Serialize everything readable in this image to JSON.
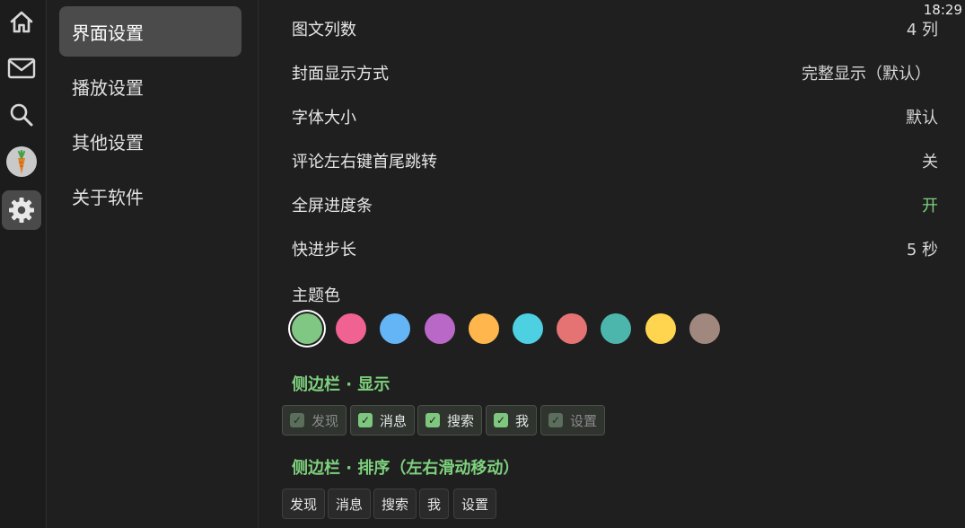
{
  "status": {
    "time": "18:29"
  },
  "rail": {
    "items": [
      {
        "name": "home",
        "icon": "home-icon"
      },
      {
        "name": "messages",
        "icon": "mail-icon"
      },
      {
        "name": "search",
        "icon": "search-icon"
      },
      {
        "name": "me",
        "icon": "avatar-carrot-icon"
      },
      {
        "name": "settings",
        "icon": "gear-icon",
        "active": true
      }
    ]
  },
  "menu": {
    "items": [
      {
        "label": "界面设置",
        "active": true
      },
      {
        "label": "播放设置"
      },
      {
        "label": "其他设置"
      },
      {
        "label": "关于软件"
      }
    ]
  },
  "settings": [
    {
      "label": "图文列数",
      "value": "4 列"
    },
    {
      "label": "封面显示方式",
      "value": "完整显示（默认）"
    },
    {
      "label": "字体大小",
      "value": "默认"
    },
    {
      "label": "评论左右键首尾跳转",
      "value": "关"
    },
    {
      "label": "全屏进度条",
      "value": "开",
      "on": true
    },
    {
      "label": "快进步长",
      "value": "5 秒"
    }
  ],
  "theme": {
    "label": "主题色",
    "colors": [
      "#81c784",
      "#f06292",
      "#64b5f6",
      "#ba68c8",
      "#ffb74d",
      "#4dd0e1",
      "#e57373",
      "#4db6ac",
      "#ffd54f",
      "#a1887f"
    ],
    "selected_index": 0
  },
  "sidebar_display": {
    "title": "侧边栏 · 显示",
    "chips": [
      {
        "label": "发现",
        "checked": true,
        "disabled": true
      },
      {
        "label": "消息",
        "checked": true
      },
      {
        "label": "搜索",
        "checked": true
      },
      {
        "label": "我",
        "checked": true
      },
      {
        "label": "设置",
        "checked": true,
        "disabled": true
      }
    ]
  },
  "sidebar_order": {
    "title": "侧边栏 · 排序（左右滑动移动）",
    "chips": [
      "发现",
      "消息",
      "搜索",
      "我",
      "设置"
    ]
  },
  "accent_color": "#7ed17e"
}
